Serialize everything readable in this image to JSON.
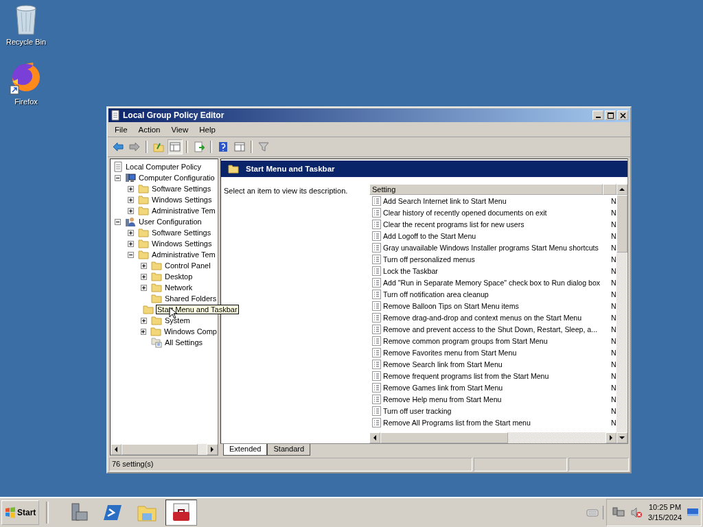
{
  "desktop_icons": [
    {
      "label": "Recycle Bin",
      "kind": "recycle"
    },
    {
      "label": "Firefox",
      "kind": "browser"
    }
  ],
  "window": {
    "title": "Local Group Policy Editor"
  },
  "menu": [
    "File",
    "Action",
    "View",
    "Help"
  ],
  "toolbar": [
    {
      "kind": "back",
      "pressed": false
    },
    {
      "kind": "forward",
      "pressed": false
    },
    {
      "kind": "up",
      "pressed": false
    },
    {
      "kind": "tree",
      "pressed": true
    },
    {
      "kind": "export",
      "pressed": false
    },
    {
      "kind": "help",
      "pressed": false
    },
    {
      "kind": "pane",
      "pressed": false
    },
    {
      "kind": "filter",
      "pressed": false
    }
  ],
  "tree": [
    {
      "label": "Local Computer Policy",
      "kind": "policy",
      "children": [
        {
          "label": "Computer Configuratio",
          "kind": "computer",
          "expanded": true,
          "children": [
            {
              "label": "Software Settings",
              "kind": "folder",
              "expanded": false
            },
            {
              "label": "Windows Settings",
              "kind": "folder",
              "expanded": false
            },
            {
              "label": "Administrative Tem",
              "kind": "folder",
              "expanded": false
            }
          ]
        },
        {
          "label": "User Configuration",
          "kind": "user",
          "expanded": true,
          "children": [
            {
              "label": "Software Settings",
              "kind": "folder",
              "expanded": false
            },
            {
              "label": "Windows Settings",
              "kind": "folder",
              "expanded": false
            },
            {
              "label": "Administrative Tem",
              "kind": "folder",
              "expanded": true,
              "children": [
                {
                  "label": "Control Panel",
                  "kind": "folder",
                  "expanded": false
                },
                {
                  "label": "Desktop",
                  "kind": "folder",
                  "expanded": false
                },
                {
                  "label": "Network",
                  "kind": "folder",
                  "expanded": false
                },
                {
                  "label": "Shared Folders",
                  "kind": "folder"
                },
                {
                  "label": "Start Menu and Taskbar",
                  "kind": "folder",
                  "tooltip": true
                },
                {
                  "label": "System",
                  "kind": "folder",
                  "expanded": false
                },
                {
                  "label": "Windows Comp",
                  "kind": "folder",
                  "expanded": false
                },
                {
                  "label": "All Settings",
                  "kind": "settings"
                }
              ]
            }
          ]
        }
      ]
    }
  ],
  "pane": {
    "title": "Start Menu and Taskbar",
    "description": "Select an item to view its description.",
    "columns": [
      "Setting"
    ]
  },
  "settings": [
    {
      "name": "Add Search Internet link to Start Menu",
      "state": "N"
    },
    {
      "name": "Clear history of recently opened documents on exit",
      "state": "N"
    },
    {
      "name": "Clear the recent programs list for new users",
      "state": "N"
    },
    {
      "name": "Add Logoff to the Start Menu",
      "state": "N"
    },
    {
      "name": "Gray unavailable Windows Installer programs Start Menu shortcuts",
      "state": "N"
    },
    {
      "name": "Turn off personalized menus",
      "state": "N"
    },
    {
      "name": "Lock the Taskbar",
      "state": "N"
    },
    {
      "name": "Add \"Run in Separate Memory Space\" check box to Run dialog box",
      "state": "N"
    },
    {
      "name": "Turn off notification area cleanup",
      "state": "N"
    },
    {
      "name": "Remove Balloon Tips on Start Menu items",
      "state": "N"
    },
    {
      "name": "Remove drag-and-drop and context menus on the Start Menu",
      "state": "N"
    },
    {
      "name": "Remove and prevent access to the Shut Down, Restart, Sleep, a...",
      "state": "N"
    },
    {
      "name": "Remove common program groups from Start Menu",
      "state": "N"
    },
    {
      "name": "Remove Favorites menu from Start Menu",
      "state": "N"
    },
    {
      "name": "Remove Search link from Start Menu",
      "state": "N"
    },
    {
      "name": "Remove frequent programs list from the Start Menu",
      "state": "N"
    },
    {
      "name": "Remove Games link from Start Menu",
      "state": "N"
    },
    {
      "name": "Remove Help menu from Start Menu",
      "state": "N"
    },
    {
      "name": "Turn off user tracking",
      "state": "N"
    },
    {
      "name": "Remove All Programs list from the Start menu",
      "state": "N"
    }
  ],
  "tabs": [
    {
      "label": "Extended",
      "selected": true
    },
    {
      "label": "Standard",
      "selected": false
    }
  ],
  "status_bar": "76 setting(s)",
  "taskbar": {
    "start": "Start",
    "apps": [
      {
        "kind": "server",
        "active": false
      },
      {
        "kind": "shell",
        "active": false
      },
      {
        "kind": "explorer",
        "active": false
      },
      {
        "kind": "toolbox",
        "active": true
      }
    ],
    "tray": [
      {
        "kind": "keyboard"
      },
      {
        "kind": "network"
      },
      {
        "kind": "muted"
      }
    ],
    "time": "10:25 PM",
    "date": "3/15/2024"
  }
}
